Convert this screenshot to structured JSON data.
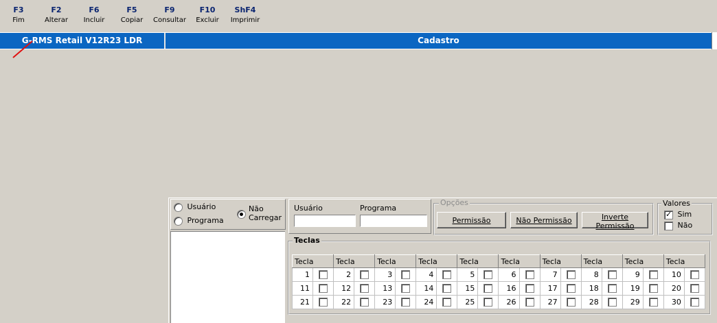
{
  "toolbar": [
    {
      "key": "F3",
      "label": "Fim"
    },
    {
      "key": "F2",
      "label": "Alterar"
    },
    {
      "key": "F6",
      "label": "Incluir"
    },
    {
      "key": "F5",
      "label": "Copiar"
    },
    {
      "key": "F9",
      "label": "Consultar"
    },
    {
      "key": "F10",
      "label": "Excluir"
    },
    {
      "key": "ShF4",
      "label": "Imprimir"
    }
  ],
  "titlebar": {
    "app": "G-RMS Retail V12R23 LDR",
    "screen": "Cadastro"
  },
  "filter": {
    "usuario": "Usuário",
    "programa": "Programa",
    "nao_carregar_1": "Não",
    "nao_carregar_2": "Carregar"
  },
  "fields": {
    "usuario_label": "Usuário",
    "usuario_value": "",
    "programa_label": "Programa",
    "programa_value": ""
  },
  "opcoes": {
    "title": "Opções",
    "permissao": "Permissão",
    "nao_permissao": "Não Permissão",
    "inverte": "Inverte Permissão"
  },
  "valores": {
    "title": "Valores",
    "sim": "Sim",
    "nao": "Não"
  },
  "teclas": {
    "title": "Teclas",
    "header": "Tecla",
    "rows": [
      [
        "1",
        "2",
        "3",
        "4",
        "5",
        "6",
        "7",
        "8",
        "9",
        "10"
      ],
      [
        "11",
        "12",
        "13",
        "14",
        "15",
        "16",
        "17",
        "18",
        "19",
        "20"
      ],
      [
        "21",
        "22",
        "23",
        "24",
        "25",
        "26",
        "27",
        "28",
        "29",
        "30"
      ]
    ]
  },
  "colors": {
    "titlebar": "#0b66c2",
    "fkey": "#0a2470",
    "background": "#d4d0c8"
  }
}
